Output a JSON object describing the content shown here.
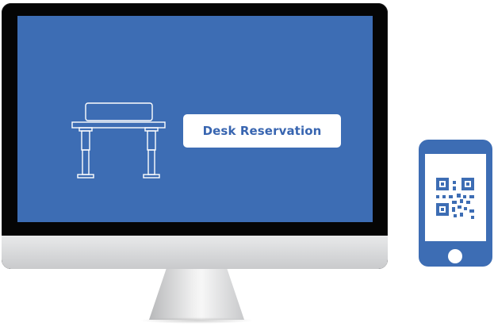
{
  "monitor": {
    "screen_color": "#3d6db4",
    "icon": "desk-icon",
    "reservation_button_label": "Desk Reservation"
  },
  "phone": {
    "body_color": "#3d6db4",
    "icon": "qr-code-icon"
  }
}
